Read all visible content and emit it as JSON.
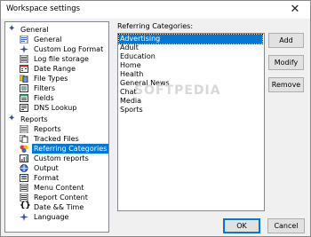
{
  "window": {
    "title": "Workspace settings",
    "close_glyph": "✕"
  },
  "tree": {
    "general": {
      "label": "General",
      "icon": "star-icon",
      "items": [
        {
          "label": "General",
          "icon": "settings-doc-icon"
        },
        {
          "label": "Custom Log Format",
          "icon": "star-small-icon"
        },
        {
          "label": "Log file storage",
          "icon": "log-file-icon"
        },
        {
          "label": "Date Range",
          "icon": "calendar-icon"
        },
        {
          "label": "File Types",
          "icon": "file-types-icon"
        },
        {
          "label": "Filters",
          "icon": "filter-icon"
        },
        {
          "label": "Fields",
          "icon": "fields-icon"
        },
        {
          "label": "DNS Lookup",
          "icon": "dns-icon"
        }
      ]
    },
    "reports": {
      "label": "Reports",
      "icon": "star-icon",
      "items": [
        {
          "label": "Reports",
          "icon": "reports-icon"
        },
        {
          "label": "Tracked Files",
          "icon": "tracked-files-icon"
        },
        {
          "label": "Referring Categories",
          "icon": "referring-categories-icon",
          "selected": true
        },
        {
          "label": "Custom reports",
          "icon": "custom-reports-icon"
        },
        {
          "label": "Output",
          "icon": "output-icon"
        },
        {
          "label": "Format",
          "icon": "format-icon"
        },
        {
          "label": "Menu Content",
          "icon": "menu-content-icon"
        },
        {
          "label": "Report Content",
          "icon": "report-content-icon"
        },
        {
          "label": "Date && Time",
          "icon": "braces-icon"
        },
        {
          "label": "Language",
          "icon": "star-small-icon"
        }
      ]
    }
  },
  "categories": {
    "label": "Referring Categories:",
    "items": [
      "Advertising",
      "Adult",
      "Education",
      "Home",
      "Health",
      "General News",
      "Chat",
      "Media",
      "Sports"
    ],
    "selected_index": 0
  },
  "buttons": {
    "add": "Add",
    "modify": "Modify",
    "remove": "Remove",
    "ok": "OK",
    "cancel": "Cancel"
  },
  "watermark": "SOFTPEDIA",
  "colors": {
    "selection": "#0078d7",
    "button_face": "#e1e1e1"
  }
}
